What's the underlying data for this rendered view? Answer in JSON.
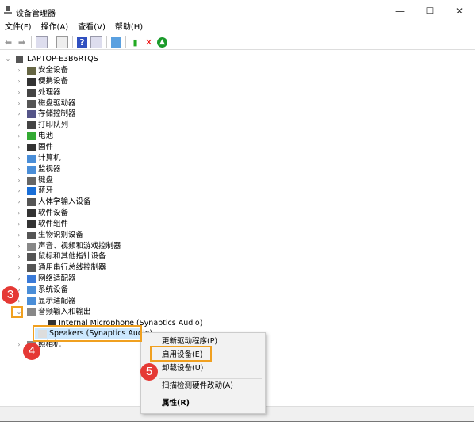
{
  "window": {
    "title": "设备管理器",
    "controls": [
      "—",
      "☐",
      "✕"
    ]
  },
  "menu": [
    "文件(F)",
    "操作(A)",
    "查看(V)",
    "帮助(H)"
  ],
  "toolbar": [
    "back-icon",
    "forward-icon",
    "properties-icon",
    "update-icon",
    "help-icon",
    "view-icon",
    "scan-icon",
    "enable-device-icon",
    "uninstall-icon",
    "update-driver-icon"
  ],
  "tree": {
    "root": "LAPTOP-E3B6RTQS",
    "items": [
      "安全设备",
      "便携设备",
      "处理器",
      "磁盘驱动器",
      "存储控制器",
      "打印队列",
      "电池",
      "固件",
      "计算机",
      "监视器",
      "键盘",
      "蓝牙",
      "人体学输入设备",
      "软件设备",
      "软件组件",
      "生物识别设备",
      "声音、视频和游戏控制器",
      "鼠标和其他指针设备",
      "通用串行总线控制器",
      "网络适配器",
      "系统设备",
      "显示适配器",
      "音频输入和输出"
    ],
    "audio_children": [
      "Internal Microphone (Synaptics Audio)",
      "Speakers (Synaptics Audio)"
    ],
    "after": "照相机"
  },
  "context_menu": {
    "items": [
      "更新驱动程序(P)",
      "启用设备(E)",
      "卸载设备(U)",
      "扫描检测硬件改动(A)",
      "属性(R)"
    ]
  },
  "steps": [
    "3",
    "4",
    "5"
  ],
  "colors": {
    "highlight": "#f0a020",
    "badge": "#e53935",
    "selection": "#cce8ff"
  }
}
